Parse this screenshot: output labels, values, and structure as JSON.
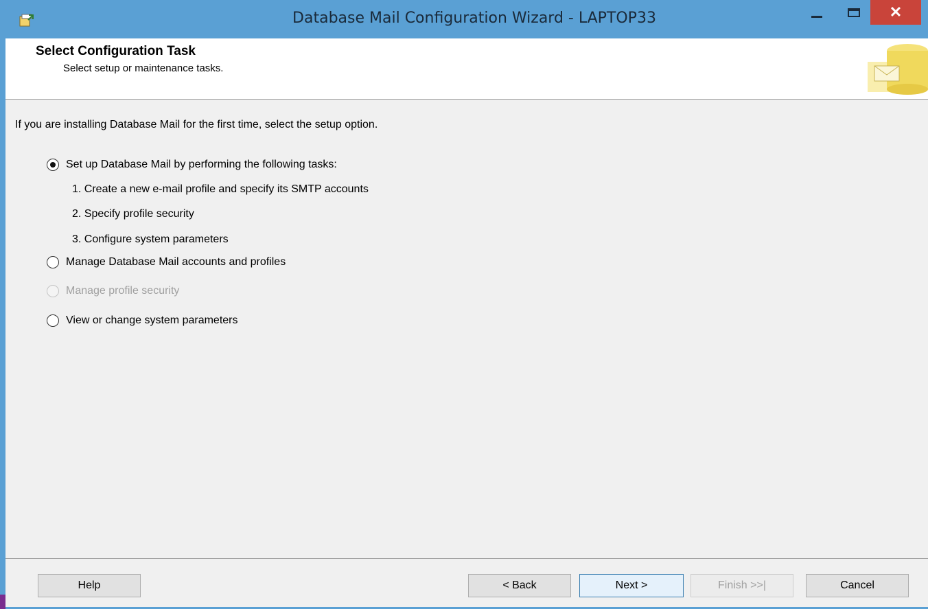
{
  "window": {
    "title": "Database Mail Configuration Wizard - LAPTOP33",
    "minimize_icon": "minimize-icon",
    "maximize_icon": "maximize-icon",
    "close_label": "✕"
  },
  "header": {
    "title": "Select Configuration Task",
    "subtitle": "Select setup or maintenance tasks."
  },
  "body": {
    "intro": "If you are installing Database Mail for the first time, select the setup option.",
    "options": [
      {
        "label": "Set up Database Mail by performing the following tasks:",
        "checked": true,
        "enabled": true
      },
      {
        "label": "Manage Database Mail accounts and profiles",
        "checked": false,
        "enabled": true
      },
      {
        "label": "Manage profile security",
        "checked": false,
        "enabled": false
      },
      {
        "label": "View or change system parameters",
        "checked": false,
        "enabled": true
      }
    ],
    "tasks": [
      "1. Create a new e-mail profile and specify its SMTP accounts",
      "2. Specify profile security",
      "3. Configure system parameters"
    ]
  },
  "footer": {
    "help": "Help",
    "back": "< Back",
    "next": "Next >",
    "finish": "Finish >>|",
    "cancel": "Cancel"
  },
  "colors": {
    "titlebar": "#5aa0d4",
    "close": "#c9443a"
  }
}
